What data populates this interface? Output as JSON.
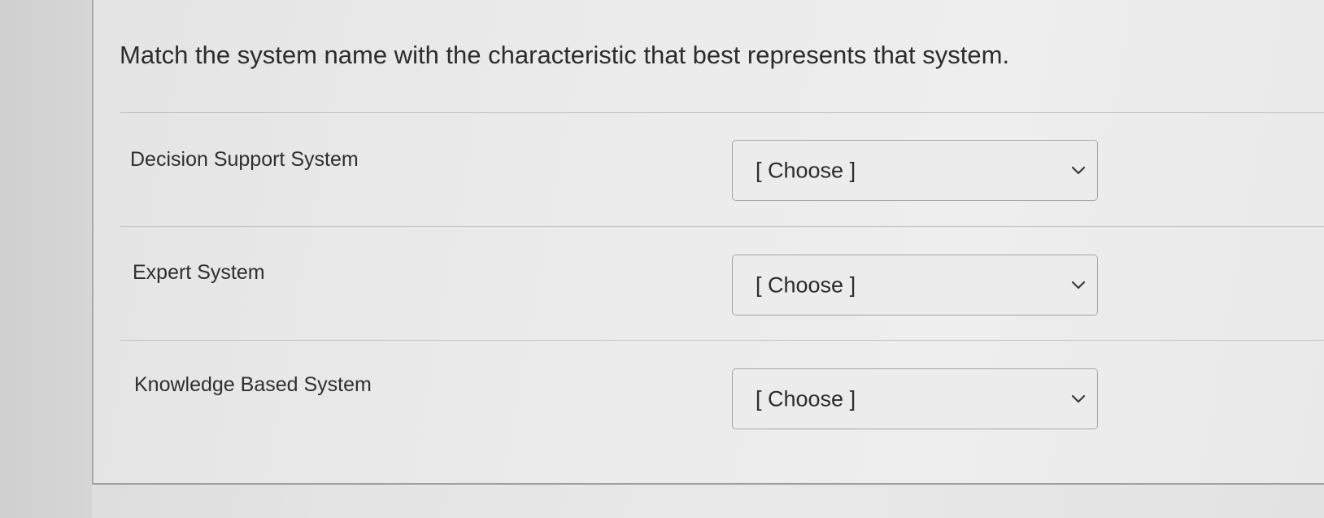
{
  "question": {
    "text": "Match the system name with the characteristic that best represents that system."
  },
  "matches": [
    {
      "label": "Decision Support System",
      "select": {
        "value": "[ Choose ]",
        "icon": "chevron-down-icon"
      }
    },
    {
      "label": "Expert System",
      "select": {
        "value": "[ Choose ]",
        "icon": "chevron-down-icon"
      }
    },
    {
      "label": "Knowledge Based System",
      "select": {
        "value": "[ Choose ]",
        "icon": "chevron-down-icon"
      }
    }
  ],
  "colors": {
    "text": "#2c2c2c",
    "divider": "#c3c3c3",
    "select_border": "#a6a6a6"
  }
}
